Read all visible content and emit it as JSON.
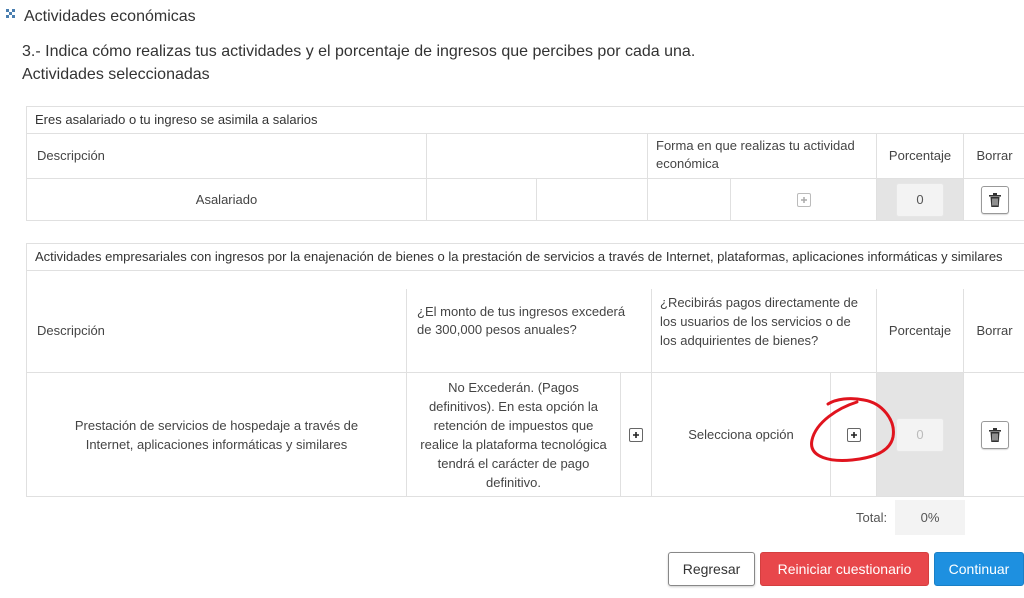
{
  "section": {
    "title": "Actividades económicas"
  },
  "question": {
    "line1": "3.- Indica cómo realizas tus actividades y el porcentaje de ingresos que percibes por cada una.",
    "line2": "Actividades seleccionadas"
  },
  "table1": {
    "heading": "Eres asalariado o tu ingreso se asimila a salarios",
    "col_descripcion": "Descripción",
    "col_forma": "Forma en que realizas tu actividad económica",
    "col_porcentaje": "Porcentaje",
    "col_borrar": "Borrar",
    "row": {
      "descripcion": "Asalariado",
      "porcentaje": "0"
    }
  },
  "table2": {
    "heading": "Actividades empresariales con ingresos por la enajenación de bienes o la prestación de servicios a través de Internet, plataformas, aplicaciones informáticas y similares",
    "col_descripcion": "Descripción",
    "col_monto": "¿El monto de tus ingresos excederá de 300,000 pesos anuales?",
    "col_pagos": "¿Recibirás pagos directamente de los usuarios de los servicios o de los adquirientes de bienes?",
    "col_porcentaje": "Porcentaje",
    "col_borrar": "Borrar",
    "row": {
      "descripcion": "Prestación de servicios de hospedaje a través de Internet, aplicaciones informáticas y similares",
      "monto": "No Excederán. (Pagos definitivos). En esta opción la retención de impuestos que realice la plataforma tecnológica tendrá el carácter de pago definitivo.",
      "pagos": "Selecciona opción",
      "porcentaje": "0"
    }
  },
  "totals": {
    "label": "Total:",
    "value": "0%"
  },
  "buttons": {
    "back": "Regresar",
    "reset": "Reiniciar cuestionario",
    "next": "Continuar"
  },
  "colors": {
    "reset": "#e8474b",
    "next": "#1e90e0",
    "annotation": "#e0141e"
  },
  "icons": {
    "expand": "expand-dots-icon",
    "add": "plus-square-icon",
    "delete": "trash-icon"
  }
}
